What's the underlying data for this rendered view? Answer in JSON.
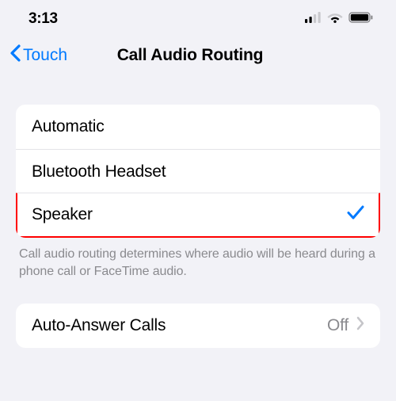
{
  "status": {
    "time": "3:13"
  },
  "nav": {
    "back_label": "Touch",
    "title": "Call Audio Routing"
  },
  "options": {
    "items": [
      {
        "label": "Automatic",
        "selected": false
      },
      {
        "label": "Bluetooth Headset",
        "selected": false
      },
      {
        "label": "Speaker",
        "selected": true
      }
    ],
    "footer": "Call audio routing determines where audio will be heard during a phone call or FaceTime audio."
  },
  "auto_answer": {
    "label": "Auto-Answer Calls",
    "value": "Off"
  }
}
